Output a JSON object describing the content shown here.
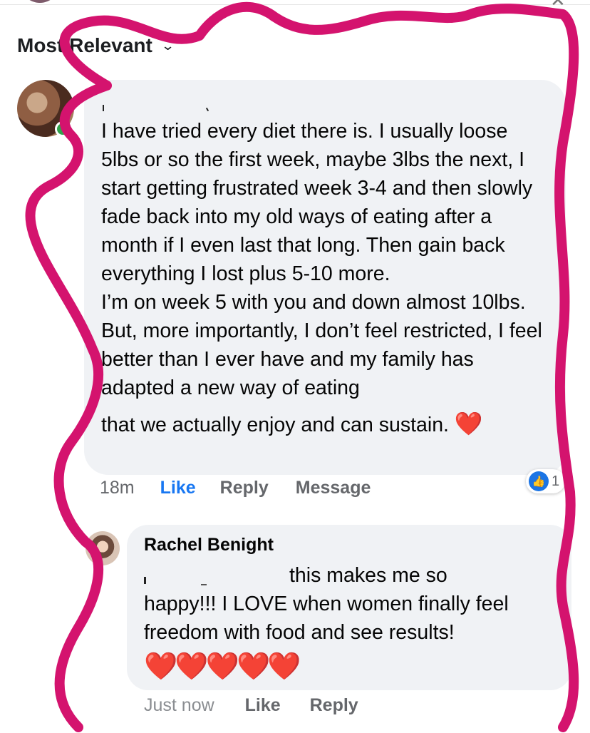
{
  "header": {
    "sort_label": "Most Relevant",
    "sort_icon": "chevron-down-icon",
    "close_icon": "close-icon"
  },
  "comment": {
    "paragraphs": [
      "I have tried every diet there is. I usually loose 5lbs or so the first week, maybe 3lbs the next, I start getting frustrated week 3-4 and then slowly fade back into my old ways of eating after a month if I even last that long. Then gain back everything I lost plus 5-10 more.",
      "I’m on week 5 with you and down almost 10lbs. But, more importantly, I don’t feel restricted, I feel better than I ever have and my family has adapted a new way of eating",
      "that we actually enjoy and can sustain."
    ],
    "emoji": "❤️",
    "time": "18m",
    "like_label": "Like",
    "reply_label": "Reply",
    "message_label": "Message",
    "reaction_count": "1",
    "online": true
  },
  "reply": {
    "author": "Rachel Benight",
    "line1": "this makes me so",
    "text": "happy!!! I LOVE when women finally feel freedom with food and see results!",
    "emojis": "❤️❤️❤️❤️❤️",
    "time": "Just now",
    "like_label": "Like",
    "reply_label": "Reply"
  },
  "colors": {
    "annotation": "#d4136e",
    "link": "#1877f2",
    "bubble": "#f0f2f5",
    "heart": "#e02036",
    "online": "#31a24c"
  }
}
